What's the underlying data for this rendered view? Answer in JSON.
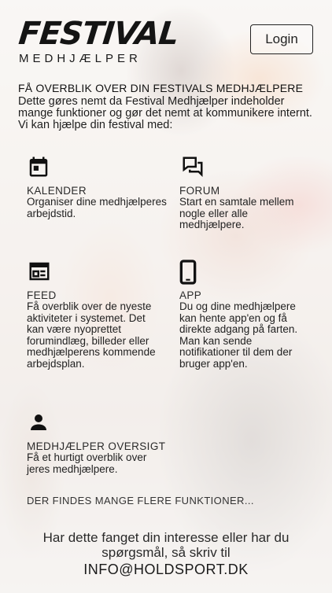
{
  "brand": {
    "logo_main": "FESTIVAL",
    "logo_sub": "MEDHJÆLPER"
  },
  "header": {
    "login_label": "Login"
  },
  "intro": {
    "heading": "FÅ OVERBLIK OVER DIN FESTIVALS MEDHJÆLPERE",
    "text": "Dette gøres nemt da Festival Medhjælper indeholder mange funktioner og gør det nemt at kommunikere internt. Vi kan hjælpe din festival med:"
  },
  "features": [
    {
      "icon": "calendar-icon",
      "title": "KALENDER",
      "desc": "Organiser dine medhjælperes arbejdstid."
    },
    {
      "icon": "forum-icon",
      "title": "FORUM",
      "desc": "Start en samtale mellem nogle eller alle medhjælpere."
    },
    {
      "icon": "feed-icon",
      "title": "FEED",
      "desc": "Få overblik over de nyeste aktiviteter i systemet. Det kan være nyoprettet forumindlæg, billeder eller medhjælperens kommende arbejdsplan."
    },
    {
      "icon": "phone-icon",
      "title": "APP",
      "desc": "Du og dine medhjælpere kan hente app'en og få direkte adgang på farten. Man kan sende notifikationer til dem der bruger app'en."
    },
    {
      "icon": "person-icon",
      "title": "MEDHJÆLPER OVERSIGT",
      "desc": "Få et hurtigt overblik over jeres medhjælpere."
    }
  ],
  "more_text": "DER FINDES MANGE FLERE FUNKTIONER...",
  "cta": {
    "text": "Har dette fanget din interesse eller har du spørgsmål, så skriv til",
    "email": "INFO@HOLDSPORT.DK"
  }
}
